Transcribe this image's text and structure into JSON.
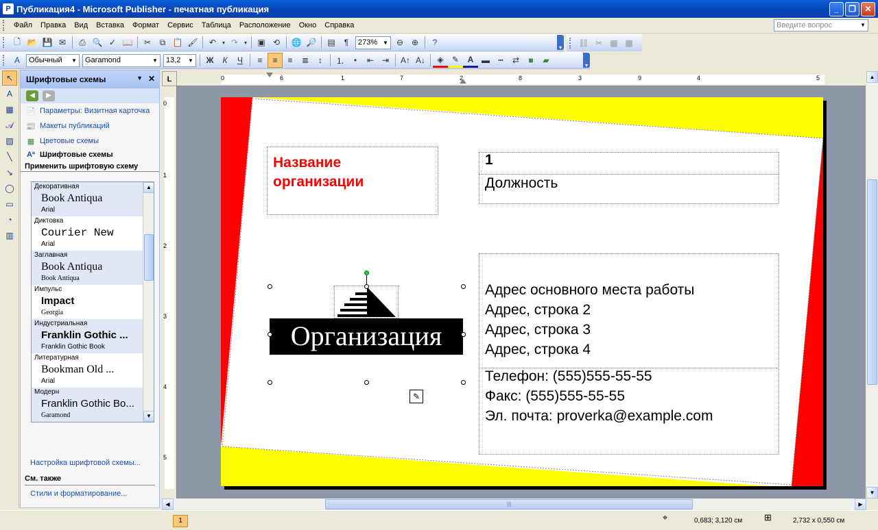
{
  "window": {
    "title": "Публикация4 - Microsoft Publisher - печатная публикация"
  },
  "menu": [
    "Файл",
    "Правка",
    "Вид",
    "Вставка",
    "Формат",
    "Сервис",
    "Таблица",
    "Расположение",
    "Окно",
    "Справка"
  ],
  "ask": {
    "placeholder": "Введите вопрос"
  },
  "toolbar1": {
    "zoom": "273%"
  },
  "toolbar2": {
    "style": "Обычный",
    "font": "Garamond",
    "size": "13,2"
  },
  "taskpane": {
    "title": "Шрифтовые схемы",
    "links": [
      "Параметры: Визитная карточка",
      "Макеты публикаций",
      "Цветовые схемы",
      "Шрифтовые схемы"
    ],
    "apply_label": "Применить шрифтовую схему",
    "schemes": [
      {
        "name": "Декоративная",
        "major": "Book Antiqua",
        "minor": "Arial"
      },
      {
        "name": "Диктовка",
        "major": "Courier New",
        "minor": "Arial"
      },
      {
        "name": "Заглавная",
        "major": "Book Antiqua",
        "minor": "Book Antiqua"
      },
      {
        "name": "Импульс",
        "major": "Impact",
        "minor": "Georgia"
      },
      {
        "name": "Индустриальная",
        "major": "Franklin Gothic ...",
        "minor": "Franklin Gothic Book"
      },
      {
        "name": "Литературная",
        "major": "Bookman Old ...",
        "minor": "Arial"
      },
      {
        "name": "Модерн",
        "major": "Franklin Gothic Bo...",
        "minor": "Garamond"
      }
    ],
    "settings_link": "Настройка шрифтовой схемы...",
    "see_also": "См. также",
    "styles_link": "Стили и форматирование..."
  },
  "ruler": {
    "h": [
      "0",
      "1",
      "2",
      "3",
      "4",
      "5",
      "6",
      "7",
      "8",
      "9"
    ],
    "v": [
      "0",
      "1",
      "2",
      "3",
      "4",
      "5"
    ]
  },
  "card": {
    "org_name": "Название организации",
    "name": "1",
    "position": "Должность",
    "address": [
      "Адрес основного места работы",
      "Адрес, строка 2",
      "Адрес, строка 3",
      "Адрес, строка 4"
    ],
    "contacts": [
      "Телефон: (555)555-55-55",
      "Факс: (555)555-55-55",
      "Эл. почта: proverka@example.com"
    ],
    "logo_text": "Организация",
    "colors": {
      "red": "#FF0000",
      "yellow": "#FFFF00"
    }
  },
  "status": {
    "page": "1",
    "position": "0,683; 3,120 см",
    "size": "2,732 x  0,550 см"
  }
}
